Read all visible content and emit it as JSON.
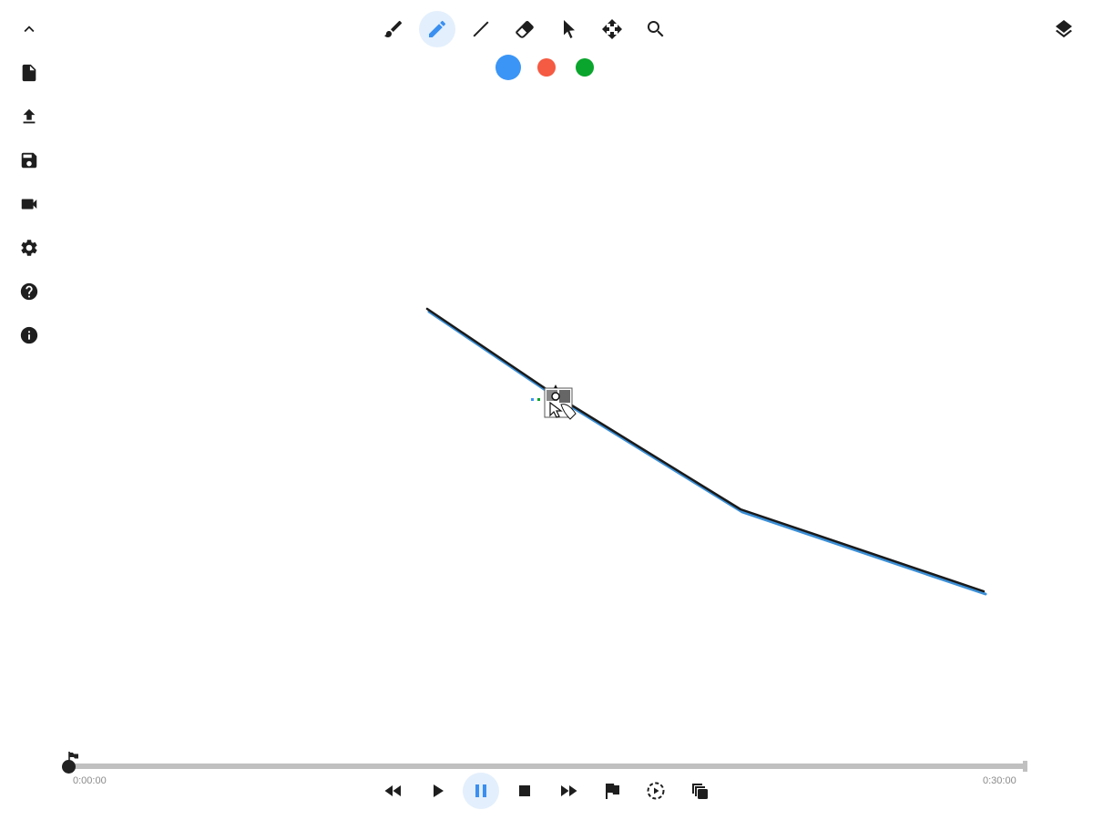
{
  "sidebar": {
    "items": [
      {
        "name": "collapse-button",
        "icon": "chevron-up-icon"
      },
      {
        "name": "new-file-button",
        "icon": "file-icon"
      },
      {
        "name": "upload-button",
        "icon": "upload-icon"
      },
      {
        "name": "save-button",
        "icon": "floppy-disk-icon"
      },
      {
        "name": "record-button",
        "icon": "video-camera-icon"
      },
      {
        "name": "settings-button",
        "icon": "gear-icon"
      },
      {
        "name": "help-button",
        "icon": "question-circle-icon"
      },
      {
        "name": "info-button",
        "icon": "info-circle-icon"
      }
    ]
  },
  "toolbar": {
    "tools": [
      {
        "name": "brush-tool",
        "icon": "paintbrush-icon",
        "active": false
      },
      {
        "name": "pencil-tool",
        "icon": "pencil-icon",
        "active": true
      },
      {
        "name": "line-tool",
        "icon": "line-icon",
        "active": false
      },
      {
        "name": "eraser-tool",
        "icon": "eraser-icon",
        "active": false
      },
      {
        "name": "select-tool",
        "icon": "pointer-icon",
        "active": false
      },
      {
        "name": "move-tool",
        "icon": "move-arrows-icon",
        "active": false
      },
      {
        "name": "zoom-tool",
        "icon": "magnifier-icon",
        "active": false
      }
    ],
    "colors": [
      {
        "name": "blue",
        "hex": "#3b95f6",
        "selected": true
      },
      {
        "name": "red",
        "hex": "#f55a42",
        "selected": false
      },
      {
        "name": "green",
        "hex": "#0aa52c",
        "selected": false
      }
    ]
  },
  "layers": {
    "icon": "layers-icon"
  },
  "canvas": {
    "stroke_color": "#1a1a1a",
    "stroke_highlight": "#3b8fd6",
    "cursor_icon": "drawing-cursor-icon"
  },
  "timeline": {
    "start_time": "0:00:00",
    "end_time": "0:30:00",
    "progress": 0,
    "marker_icon": "flag-icon"
  },
  "playback": {
    "controls": [
      {
        "name": "rewind-button",
        "icon": "rewind-icon",
        "active": false
      },
      {
        "name": "play-button",
        "icon": "play-icon",
        "active": false
      },
      {
        "name": "pause-button",
        "icon": "pause-icon",
        "active": true
      },
      {
        "name": "stop-button",
        "icon": "stop-icon",
        "active": false
      },
      {
        "name": "fast-forward-button",
        "icon": "fast-forward-icon",
        "active": false
      },
      {
        "name": "add-marker-button",
        "icon": "flag-icon",
        "active": false
      },
      {
        "name": "replay-button",
        "icon": "replay-circle-icon",
        "active": false
      },
      {
        "name": "copy-frames-button",
        "icon": "copy-stack-icon",
        "active": false
      }
    ],
    "accent_color": "#3b8ff0"
  }
}
